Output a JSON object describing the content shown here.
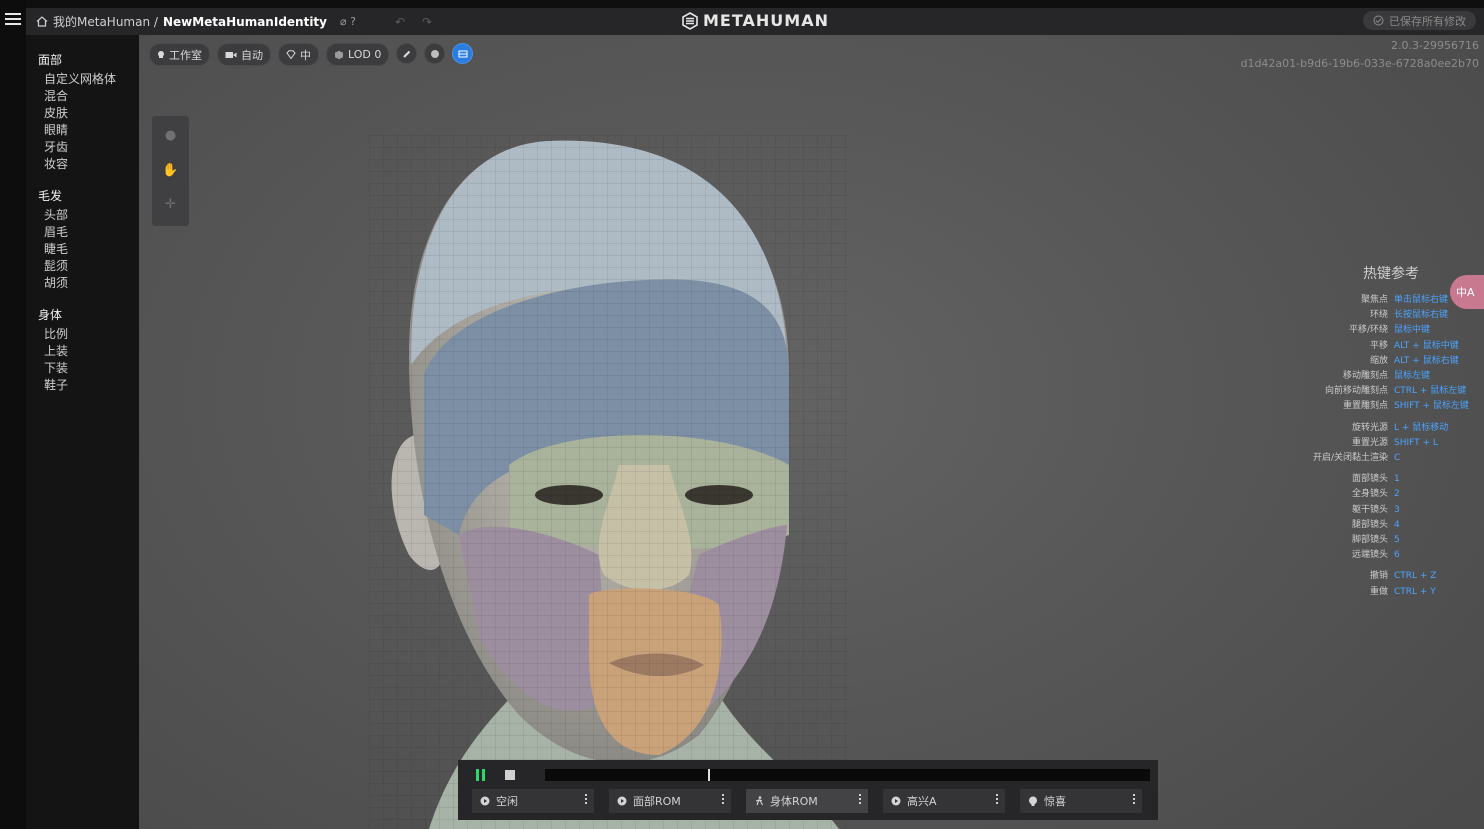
{
  "topbar": {
    "home_label": "我的MetaHuman /",
    "identity_name": "NewMetaHumanIdentity",
    "edit_hint": "⌀ ?",
    "logo_text": "METAHUMAN",
    "saved_status": "已保存所有修改"
  },
  "sidebar": {
    "groups": [
      {
        "title": "面部",
        "items": [
          "自定义网格体",
          "混合",
          "皮肤",
          "眼睛",
          "牙齿",
          "妆容"
        ]
      },
      {
        "title": "毛发",
        "items": [
          "头部",
          "眉毛",
          "睫毛",
          "髭须",
          "胡须"
        ]
      },
      {
        "title": "身体",
        "items": [
          "比例",
          "上装",
          "下装",
          "鞋子"
        ]
      }
    ]
  },
  "toolbar": {
    "studio": "工作室",
    "camera": "自动",
    "quality": "中",
    "lod": "LOD 0"
  },
  "version": {
    "number": "2.0.3-29956716",
    "id": "d1d42a01-b9d6-19b6-033e-6728a0ee2b70"
  },
  "hotkeys": {
    "title": "热键参考",
    "rows": [
      {
        "action": "聚焦点",
        "key": "单击鼠标右键"
      },
      {
        "action": "环绕",
        "key": "长按鼠标右键"
      },
      {
        "action": "平移/环绕",
        "key": "鼠标中键"
      },
      {
        "action": "平移",
        "key": "ALT + 鼠标中键"
      },
      {
        "action": "缩放",
        "key": "ALT + 鼠标右键"
      },
      {
        "action": "移动雕刻点",
        "key": "鼠标左键"
      },
      {
        "action": "向前移动雕刻点",
        "key": "CTRL + 鼠标左键"
      },
      {
        "action": "重置雕刻点",
        "key": "SHIFT + 鼠标左键"
      },
      {
        "action": "旋转光源",
        "key": "L + 鼠标移动"
      },
      {
        "action": "重置光源",
        "key": "SHIFT + L"
      },
      {
        "action": "开启/关闭黏土渲染",
        "key": "C"
      },
      {
        "action": "面部镜头",
        "key": "1"
      },
      {
        "action": "全身镜头",
        "key": "2"
      },
      {
        "action": "躯干镜头",
        "key": "3"
      },
      {
        "action": "腿部镜头",
        "key": "4"
      },
      {
        "action": "脚部镜头",
        "key": "5"
      },
      {
        "action": "远端镜头",
        "key": "6"
      },
      {
        "action": "撤销",
        "key": "CTRL + Z"
      },
      {
        "action": "重做",
        "key": "CTRL + Y"
      }
    ],
    "translate_badge": "中A"
  },
  "player": {
    "progress": 0.27,
    "animations": [
      "空闲",
      "面部ROM",
      "身体ROM",
      "高兴A",
      "惊喜"
    ],
    "selected_index": 2
  }
}
